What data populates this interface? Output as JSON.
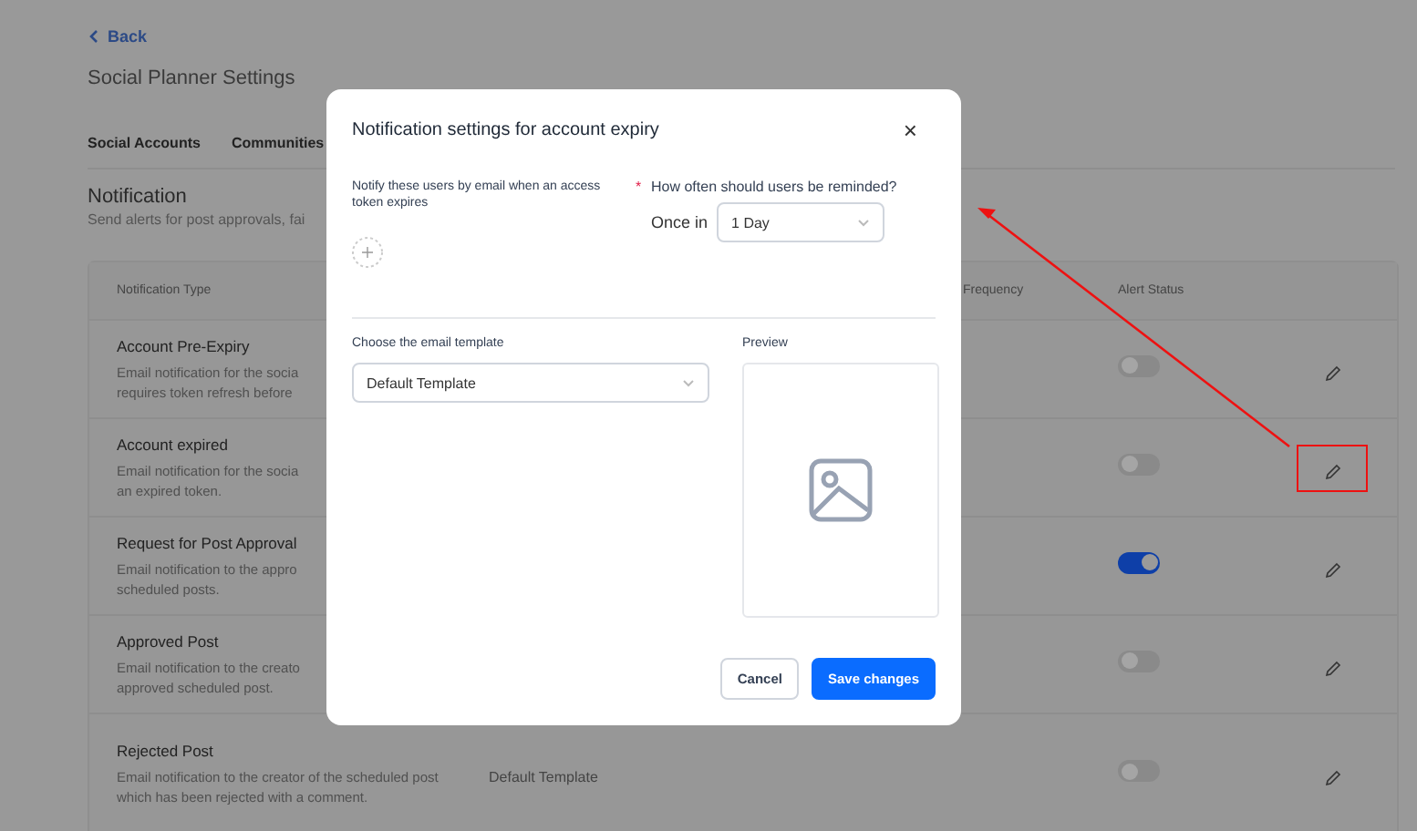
{
  "page": {
    "back": "Back",
    "title": "Social Planner Settings",
    "tabs": [
      {
        "label": "Social Accounts",
        "selected": false
      },
      {
        "label": "Communities",
        "selected": false
      }
    ],
    "section": {
      "heading": "Notification",
      "subtitle": "Send alerts for post approvals, fai"
    }
  },
  "table": {
    "columns": [
      "Notification Type",
      "Frequency",
      "Alert Status"
    ],
    "rows": [
      {
        "title": "Account Pre-Expiry",
        "description": [
          "Email notification for the socia",
          "requires token refresh before"
        ],
        "on": false,
        "highlighted": false
      },
      {
        "title": "Account expired",
        "description": [
          "Email notification for the socia",
          "an expired token."
        ],
        "on": false,
        "highlighted": true
      },
      {
        "title": "Request for Post Approval",
        "description": [
          "Email notification to the appro",
          "scheduled posts."
        ],
        "on": true,
        "highlighted": false
      },
      {
        "title": "Approved Post",
        "description": [
          "Email notification to the creato",
          "approved scheduled post."
        ],
        "on": false,
        "highlighted": false
      },
      {
        "title": "Rejected Post",
        "description": [
          "Email notification to the creator of the scheduled post which has been rejected with a comment."
        ],
        "template": "Default Template",
        "on": false,
        "highlighted": false
      }
    ]
  },
  "dialog": {
    "title": "Notification settings for account expiry",
    "close": "×",
    "users_label": "Notify these users by email when an access token expires",
    "required_mark": "*",
    "reminder_label": "How often should users be reminded?",
    "once_in": "Once in",
    "reminder_value": "1 Day",
    "template_label": "Choose the email template",
    "template_value": "Default Template",
    "preview_label": "Preview",
    "buttons": [
      {
        "label": "Cancel",
        "kind": "secondary"
      },
      {
        "label": "Save changes",
        "kind": "primary"
      }
    ]
  }
}
